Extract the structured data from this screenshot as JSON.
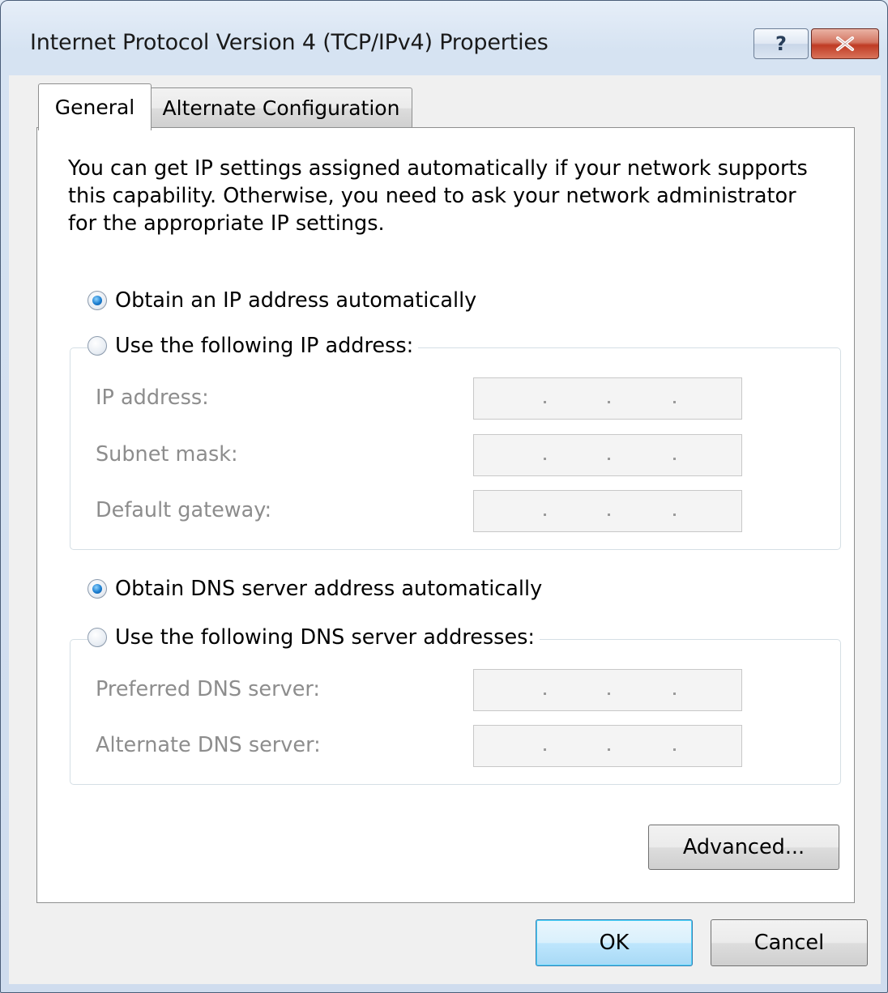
{
  "window": {
    "title": "Internet Protocol Version 4 (TCP/IPv4) Properties",
    "help_button": "?",
    "close_icon": "close-x-icon"
  },
  "tabs": [
    {
      "label": "General",
      "selected": true
    },
    {
      "label": "Alternate Configuration",
      "selected": false
    }
  ],
  "general": {
    "intro": "You can get IP settings assigned automatically if your network supports this capability. Otherwise, you need to ask your network administrator for the appropriate IP settings.",
    "ip_mode": {
      "auto_label": "Obtain an IP address automatically",
      "manual_label": "Use the following IP address:",
      "selected": "auto"
    },
    "ip_fields": [
      {
        "label": "IP address:",
        "value": " .  .  . "
      },
      {
        "label": "Subnet mask:",
        "value": " .  .  . "
      },
      {
        "label": "Default gateway:",
        "value": " .  .  . "
      }
    ],
    "dns_mode": {
      "auto_label": "Obtain DNS server address automatically",
      "manual_label": "Use the following DNS server addresses:",
      "selected": "auto"
    },
    "dns_fields": [
      {
        "label": "Preferred DNS server:",
        "value": " .  .  . "
      },
      {
        "label": "Alternate DNS server:",
        "value": " .  .  . "
      }
    ],
    "advanced_label": "Advanced..."
  },
  "footer": {
    "ok_label": "OK",
    "cancel_label": "Cancel"
  },
  "colors": {
    "accent_radio": "#1c7fd0",
    "disabled_text": "#8d8d8d",
    "panel_bg": "#ffffff",
    "dialog_bg": "#f0f0f0"
  }
}
